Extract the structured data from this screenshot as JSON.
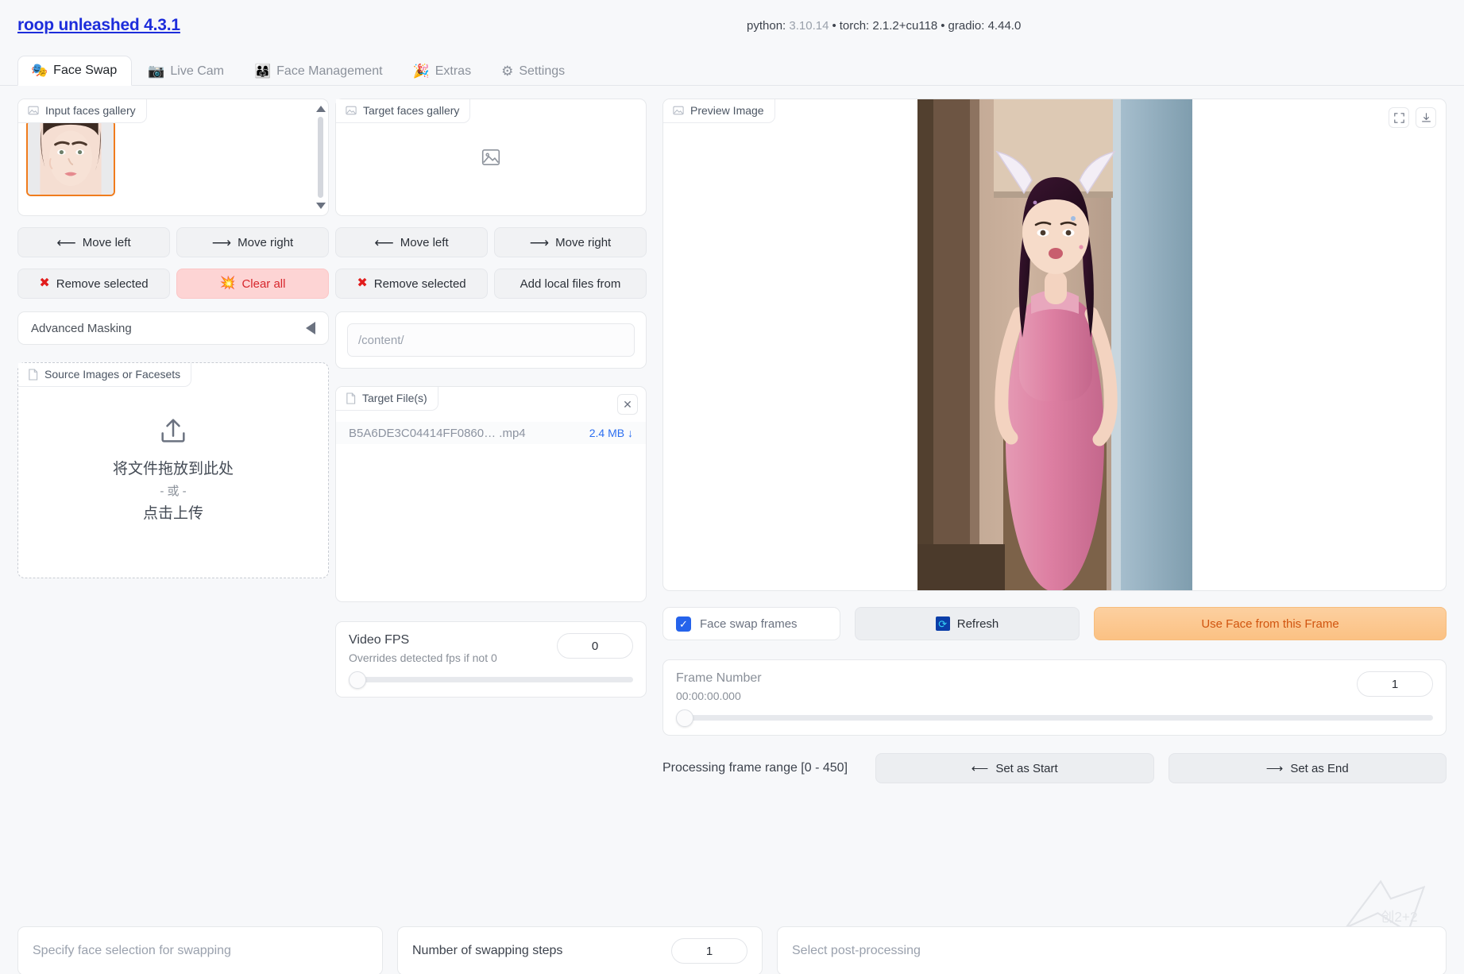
{
  "header": {
    "app_title": "roop unleashed 4.3.1",
    "versions": {
      "python_label": "python:",
      "python_value": "3.10.14",
      "torch_label": "torch:",
      "torch_value": "2.1.2+cu118",
      "gradio_label": "gradio:",
      "gradio_value": "4.44.0",
      "separator": "•"
    }
  },
  "tabs": [
    {
      "label": "Face Swap",
      "icon": "🎭",
      "active": true
    },
    {
      "label": "Live Cam",
      "icon": "📷",
      "active": false
    },
    {
      "label": "Face Management",
      "icon": "👨‍👩‍👧",
      "active": false
    },
    {
      "label": "Extras",
      "icon": "🎉",
      "active": false
    },
    {
      "label": "Settings",
      "icon": "⚙",
      "active": false
    }
  ],
  "left_column": {
    "gallery_label": "Input faces gallery",
    "buttons": {
      "move_left": "Move left",
      "move_right": "Move right",
      "remove_selected": "Remove selected",
      "clear_all": "Clear all",
      "move_left_arrow": "⟵",
      "move_right_arrow": "⟶",
      "remove_icon": "✖",
      "clear_icon": "💥"
    },
    "advanced_masking": "Advanced Masking",
    "upload": {
      "label": "Source Images or Facesets",
      "drop_text": "将文件拖放到此处",
      "or_text": "- 或 -",
      "click_text": "点击上传"
    }
  },
  "mid_column": {
    "gallery_label": "Target faces gallery",
    "buttons": {
      "move_left": "Move left",
      "move_right": "Move right",
      "remove_selected": "Remove selected",
      "add_local_files": "Add local files from",
      "move_left_arrow": "⟵",
      "move_right_arrow": "⟶",
      "remove_icon": "✖"
    },
    "path_input": {
      "value": "",
      "placeholder": "/content/"
    },
    "target_files": {
      "label": "Target File(s)",
      "rows": [
        {
          "name": "B5A6DE3C04414FF0860… .mp4",
          "size": "2.4 MB"
        }
      ],
      "download_glyph": "↓",
      "close_glyph": "✕"
    },
    "video_fps": {
      "label": "Video FPS",
      "info": "Overrides detected fps if not 0",
      "value": "0",
      "slider_percent": 0
    }
  },
  "right_column": {
    "preview_label": "Preview Image",
    "tools": {
      "fullscreen": "fullscreen-icon",
      "download": "download-icon"
    },
    "controls": {
      "face_swap_frames": "Face swap frames",
      "face_swap_frames_checked": true,
      "refresh": "Refresh",
      "use_face_from_frame": "Use Face from this Frame"
    },
    "frame_number": {
      "label": "Frame Number",
      "timecode": "00:00:00.000",
      "value": "1",
      "slider_percent": 0
    },
    "frame_range": {
      "label": "Processing frame range [0 - 450]",
      "set_as_start": "Set as Start",
      "set_as_end": "Set as End",
      "start_arrow": "⟵",
      "end_arrow": "⟶"
    }
  },
  "bottom": {
    "face_selection_placeholder": "Specify face selection for swapping",
    "swapping_steps_label": "Number of swapping steps",
    "swapping_steps_value": "1",
    "post_processing_placeholder": "Select post-processing"
  }
}
